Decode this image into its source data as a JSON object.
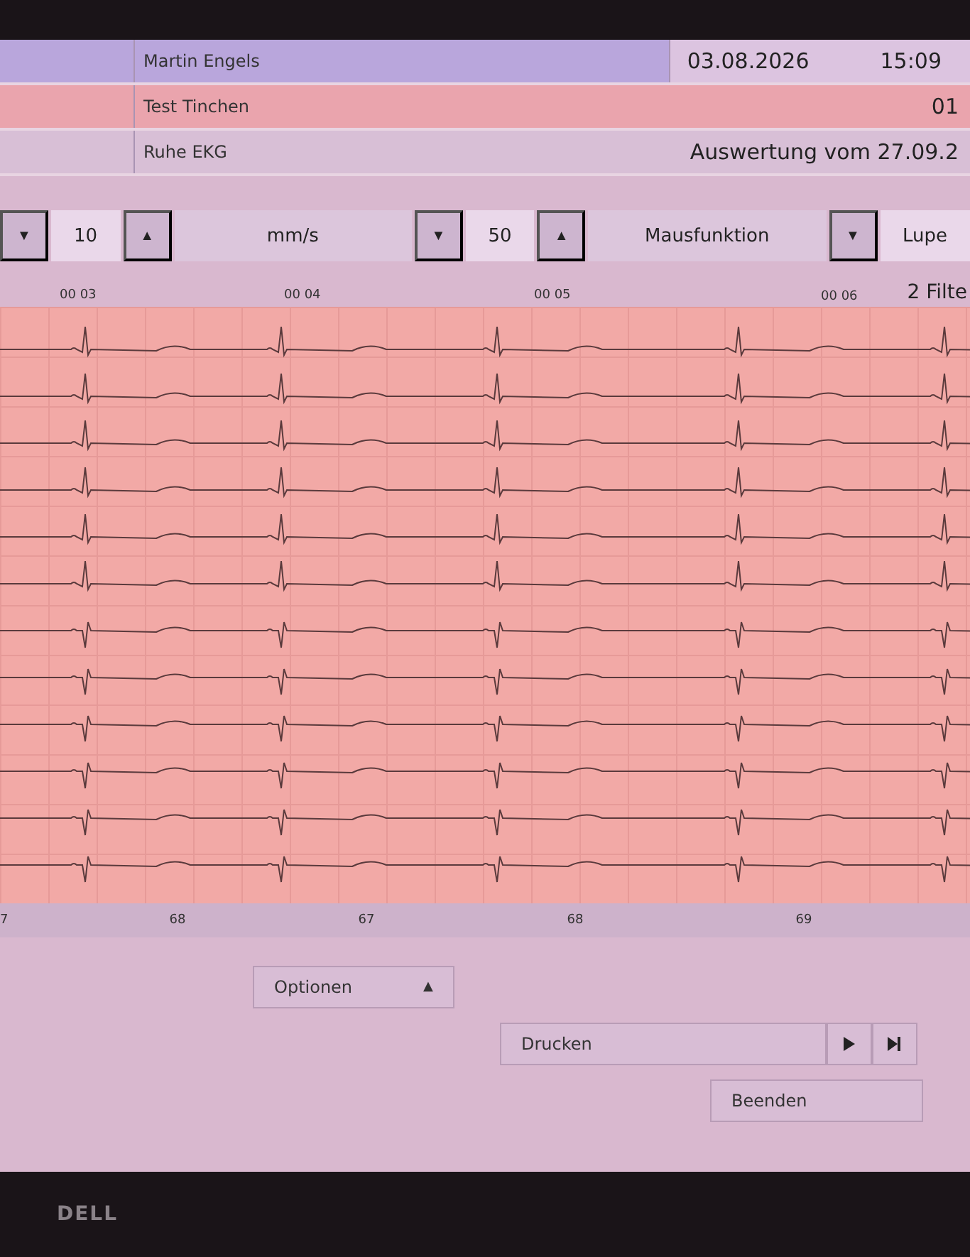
{
  "header": {
    "rows": [
      {
        "kind": "patient",
        "name": "Martin Engels",
        "date": "03.08.2026",
        "time": "15:09"
      },
      {
        "kind": "test",
        "name": "Test Tinchen",
        "value": "01"
      },
      {
        "kind": "exam",
        "name": "Ruhe EKG",
        "value": "Auswertung vom 27.09.2"
      }
    ]
  },
  "toolbar": [
    {
      "kind": "down",
      "text": "▼"
    },
    {
      "kind": "value",
      "text": "10"
    },
    {
      "kind": "up",
      "text": "▲"
    },
    {
      "kind": "label",
      "text": "mm/s"
    },
    {
      "kind": "down",
      "text": "▼"
    },
    {
      "kind": "value",
      "text": "50"
    },
    {
      "kind": "up",
      "text": "▲"
    },
    {
      "kind": "label",
      "text": "Mausfunktion"
    },
    {
      "kind": "down",
      "text": "▼"
    },
    {
      "kind": "value",
      "text": "Lupe"
    }
  ],
  "timeline": {
    "marks": [
      "00 03",
      "00 04",
      "00 05",
      "00 06"
    ],
    "filter": "2 Filte"
  },
  "heart_rates": [
    "7",
    "68",
    "67",
    "68",
    "69"
  ],
  "buttons": {
    "options": {
      "label": "Optionen",
      "arrow": "▲"
    },
    "print": "Drucken",
    "quit": "Beenden"
  },
  "bezel_logo": "DELL"
}
